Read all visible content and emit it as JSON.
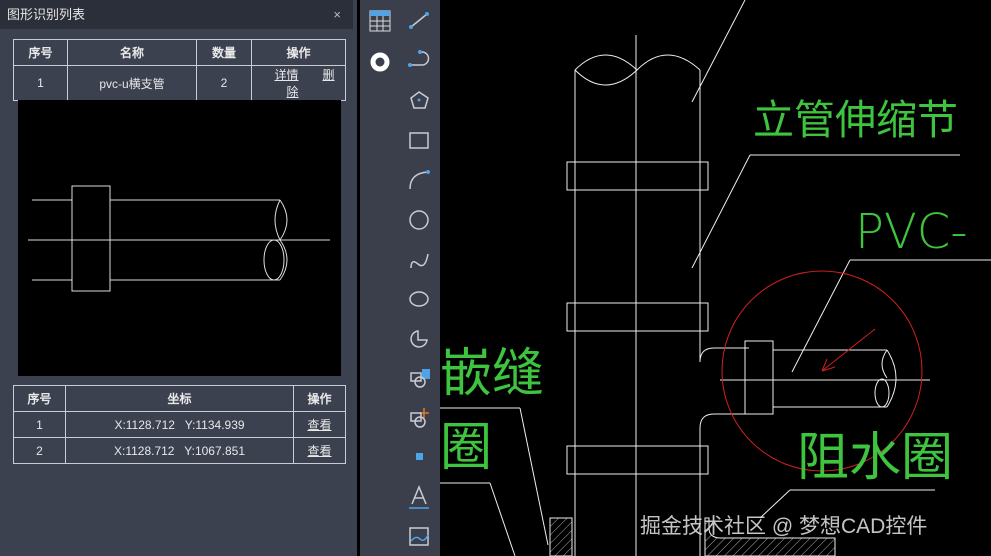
{
  "panel": {
    "title": "图形识别列表",
    "close": "×"
  },
  "table1": {
    "headers": [
      "序号",
      "名称",
      "数量",
      "操作"
    ],
    "rows": [
      {
        "index": "1",
        "name": "pvc-u横支管",
        "count": "2",
        "detail": "详情",
        "delete": "删除"
      }
    ]
  },
  "table2": {
    "headers": [
      "序号",
      "坐标",
      "操作"
    ],
    "rows": [
      {
        "index": "1",
        "coord": "X:1128.712   Y:1134.939",
        "action": "查看"
      },
      {
        "index": "2",
        "coord": "X:1128.712   Y:1067.851",
        "action": "查看"
      }
    ]
  },
  "canvas": {
    "labels": {
      "riser": "立管伸缩节",
      "pvc": "PVC-",
      "water_ring": "阻水圈",
      "caulk": "嵌缝",
      "ring": "圈"
    }
  },
  "watermark": "掘金技术社区 @ 梦想CAD控件",
  "colors": {
    "accent": "#4fa3e8",
    "cad_text": "#3ec43e",
    "selection": "#d02020"
  }
}
